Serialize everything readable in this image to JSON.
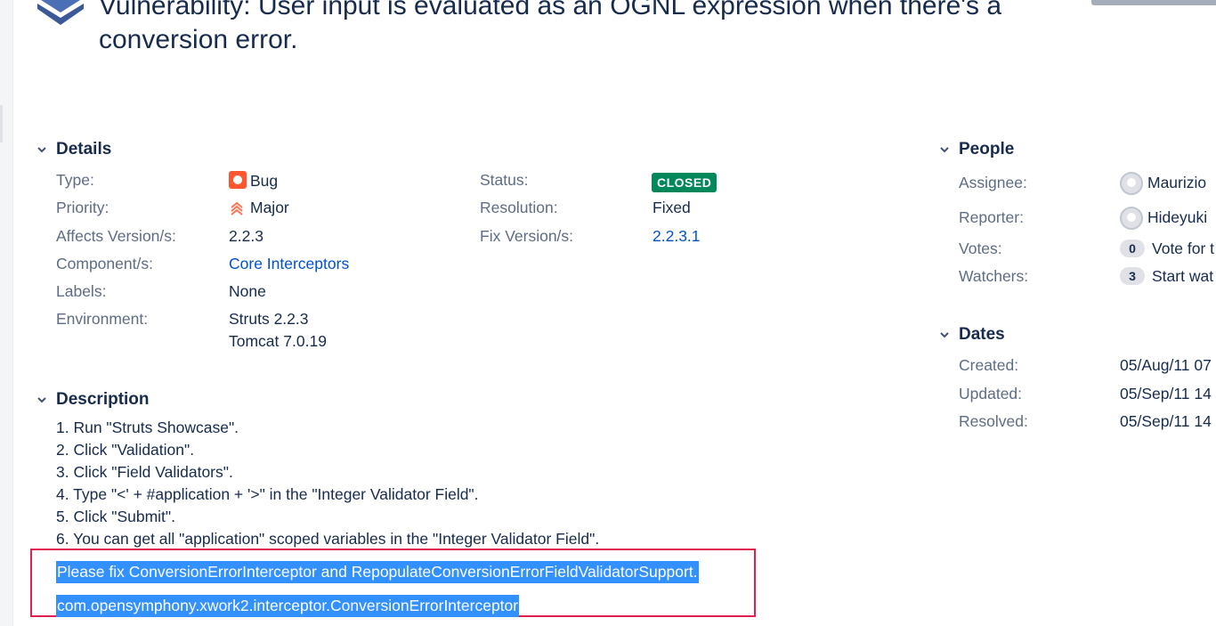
{
  "issue": {
    "summary_line1": "Vulnerability: User input is evaluated as an OGNL expression when there's a",
    "summary_line2": "conversion error."
  },
  "details": {
    "heading": "Details",
    "type_label": "Type:",
    "type_value": "Bug",
    "priority_label": "Priority:",
    "priority_value": "Major",
    "affects_label": "Affects Version/s:",
    "affects_value": "2.2.3",
    "component_label": "Component/s:",
    "component_value": "Core Interceptors",
    "labels_label": "Labels:",
    "labels_value": "None",
    "environment_label": "Environment:",
    "environment_value_1": "Struts 2.2.3",
    "environment_value_2": "Tomcat 7.0.19",
    "status_label": "Status:",
    "status_value": "CLOSED",
    "resolution_label": "Resolution:",
    "resolution_value": "Fixed",
    "fix_label": "Fix Version/s:",
    "fix_value": "2.2.3.1"
  },
  "people": {
    "heading": "People",
    "assignee_label": "Assignee:",
    "assignee_value": "Maurizio",
    "reporter_label": "Reporter:",
    "reporter_value": "Hideyuki",
    "votes_label": "Votes:",
    "votes_count": "0",
    "votes_text": "Vote for t",
    "watchers_label": "Watchers:",
    "watchers_count": "3",
    "watchers_text": "Start wat"
  },
  "dates": {
    "heading": "Dates",
    "created_label": "Created:",
    "created_value": "05/Aug/11 07",
    "updated_label": "Updated:",
    "updated_value": "05/Sep/11 14",
    "resolved_label": "Resolved:",
    "resolved_value": "05/Sep/11 14"
  },
  "description": {
    "heading": "Description",
    "lines": [
      "1. Run \"Struts Showcase\".",
      "2. Click \"Validation\".",
      "3. Click \"Field Validators\".",
      "4. Type \"<' + #application + '>\" in the \"Integer Validator Field\".",
      "5. Click \"Submit\".",
      "6. You can get all \"application\" scoped variables in the \"Integer Validator Field\"."
    ],
    "selected_line_1": "Please fix ConversionErrorInterceptor and RepopulateConversionErrorFieldValidatorSupport.",
    "selected_line_2": "com.opensymphony.xwork2.interceptor.ConversionErrorInterceptor"
  },
  "colors": {
    "status_closed": "#00875a",
    "link": "#0052cc",
    "bug": "#ff5630",
    "priority_major": "#ff7452",
    "selection": "#3390ff",
    "highlight_border": "#e0204f"
  },
  "icons": [
    "project-avatar-icon",
    "chevron-down-icon",
    "bug-icon",
    "priority-major-icon",
    "user-avatar-icon"
  ]
}
